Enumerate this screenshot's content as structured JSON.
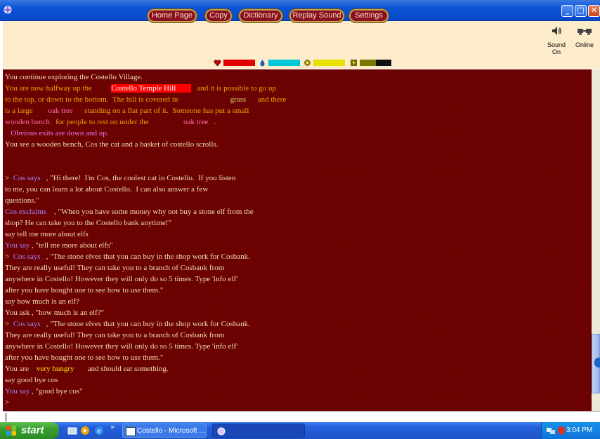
{
  "window": {
    "minimize": "_",
    "maximize": "□",
    "close": "✕"
  },
  "toolbar": {
    "buttons": [
      "Home Page",
      "Copy",
      "Dictionary",
      "Replay Sound",
      "Settings"
    ],
    "sound_label": "Sound On",
    "online_label": "Online",
    "stats": [
      {
        "icon": "heart-icon",
        "color": "#e00000",
        "level": 1.0
      },
      {
        "icon": "droplet-icon",
        "color": "#00c8d8",
        "level": 1.0
      },
      {
        "icon": "food-icon",
        "color": "#e8e000",
        "level": 1.0
      },
      {
        "icon": "energy-icon",
        "color": "#7a7a00",
        "level": 0.5
      }
    ]
  },
  "output": {
    "lines": [
      [
        {
          "t": "You continue exploring the Costello Village."
        }
      ],
      [
        {
          "t": "You are now halfway up the          ",
          "c": "o"
        },
        {
          "t": "Costello Temple Hill        ",
          "c": "hl"
        },
        {
          "t": "   and it is possible to go up",
          "c": "o"
        }
      ],
      [
        {
          "t": "to the top, or down to the bottom.  The hill is covered in                           ",
          "c": "o"
        },
        {
          "t": "grass",
          "c": "green"
        },
        {
          "t": "      and there",
          "c": "o"
        }
      ],
      [
        {
          "t": "is a large        ",
          "c": "o"
        },
        {
          "t": "oak tree",
          "c": "p"
        },
        {
          "t": "      standing on a flat part of it.  Someone has put a small",
          "c": "o"
        }
      ],
      [
        {
          "t": "wooden bench",
          "c": "p"
        },
        {
          "t": "   for people to rest on under the                  ",
          "c": "o"
        },
        {
          "t": "oak tree",
          "c": "p"
        },
        {
          "t": "   .",
          "c": "o"
        }
      ],
      [
        {
          "t": "   Obvious exits are down and up.",
          "c": "m"
        }
      ],
      [
        {
          "t": "You see a wooden bench, Cos the cat and a basket of costello scrolls."
        }
      ],
      [
        {
          "t": ""
        }
      ],
      [
        {
          "t": ""
        }
      ],
      [
        {
          "t": ">  "
        },
        {
          "t": "Cos says",
          "c": "b"
        },
        {
          "t": "   , \"Hi there!  I'm Cos, the coolest cat in Costello.  If you listen"
        }
      ],
      [
        {
          "t": "to me, you can learn a lot about Costello.  I can also answer a few"
        }
      ],
      [
        {
          "t": "questions.\""
        }
      ],
      [
        {
          "t": "Cos exclaims",
          "c": "b"
        },
        {
          "t": "    , \"When you have some money why not buy a stone elf from the"
        }
      ],
      [
        {
          "t": "shop? He can take you to the Costello bank anytime!\""
        }
      ],
      [
        {
          "t": "say tell me more about elfs"
        }
      ],
      [
        {
          "t": "You say",
          "c": "b"
        },
        {
          "t": " , \"tell me more about elfs\""
        }
      ],
      [
        {
          "t": ">  "
        },
        {
          "t": "Cos says",
          "c": "b"
        },
        {
          "t": "   , \"The stone elves that you can buy in the shop work for Cosbank."
        }
      ],
      [
        {
          "t": "They are really useful! They can take you to a branch of Cosbank from"
        }
      ],
      [
        {
          "t": "anywhere in Costello! However they will only do so 5 times. Type 'info elf'"
        }
      ],
      [
        {
          "t": "after you have bought one to see how to use them.\""
        }
      ],
      [
        {
          "t": "say how much is an elf?"
        }
      ],
      [
        {
          "t": "You ask , \"how much is an elf?\""
        }
      ],
      [
        {
          "t": ">  "
        },
        {
          "t": "Cos says",
          "c": "b"
        },
        {
          "t": "   , \"The stone elves that you can buy in the shop work for Cosbank."
        }
      ],
      [
        {
          "t": "They are really useful! They can take you to a branch of Cosbank from"
        }
      ],
      [
        {
          "t": "anywhere in Costello! However they will only do so 5 times. Type 'info elf'"
        }
      ],
      [
        {
          "t": "after you have bought one to see how to use them.\""
        }
      ],
      [
        {
          "t": "You are    "
        },
        {
          "t": "very hungry",
          "c": "y"
        },
        {
          "t": "       and should eat something."
        }
      ],
      [
        {
          "t": "say good bye cos"
        }
      ],
      [
        {
          "t": "You say",
          "c": "b"
        },
        {
          "t": " , \"good bye cos\""
        }
      ],
      [
        {
          "t": ">"
        }
      ]
    ]
  },
  "taskbar": {
    "start_label": "start",
    "chevron": "»",
    "task1_label": "Costello - Microsoft ...",
    "task2_label": "",
    "clock": "3:04 PM"
  }
}
